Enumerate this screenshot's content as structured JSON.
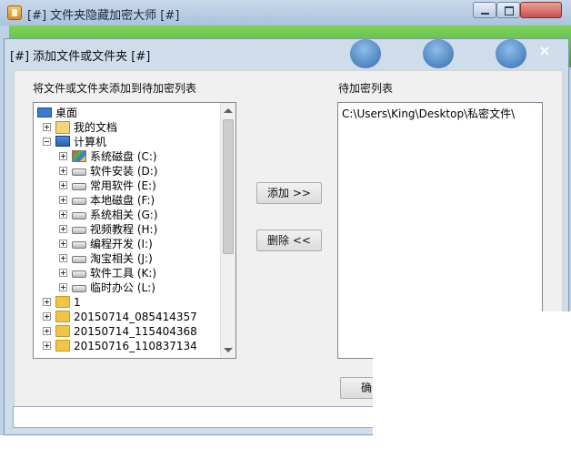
{
  "main_window": {
    "title": "[#] 文件夹隐藏加密大师 [#]"
  },
  "dialog": {
    "title": "[#] 添加文件或文件夹 [#]",
    "close_glyph": "×",
    "source_label": "将文件或文件夹添加到待加密列表",
    "target_label": "待加密列表",
    "add_button": "添加 >>",
    "remove_button": "删除 <<",
    "ok_button": "确",
    "tree": {
      "root": "桌面",
      "my_docs": "我的文档",
      "computer": "计算机",
      "drives": [
        "系统磁盘 (C:)",
        "软件安装 (D:)",
        "常用软件 (E:)",
        "本地磁盘 (F:)",
        "系统相关 (G:)",
        "视频教程 (H:)",
        "编程开发 (I:)",
        "淘宝相关 (J:)",
        "软件工具 (K:)",
        "临时办公 (L:)"
      ],
      "folders": [
        "1",
        "20150714_085414357",
        "20150714_115404368",
        "20150716_110837134"
      ]
    },
    "list_items": [
      "C:\\Users\\King\\Desktop\\私密文件\\"
    ]
  }
}
